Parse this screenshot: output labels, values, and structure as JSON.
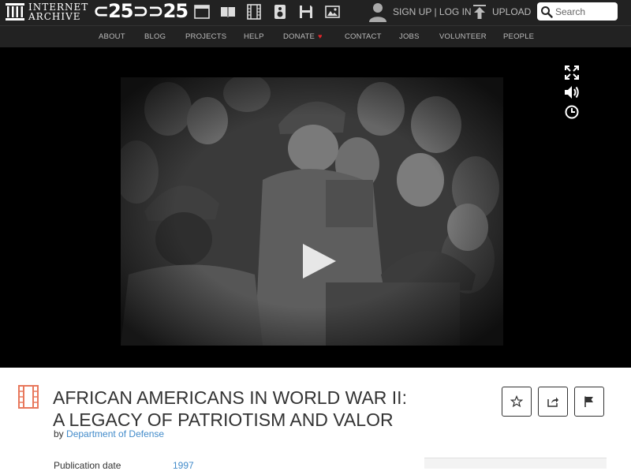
{
  "topbar": {
    "logo_line1": "INTERNET",
    "logo_line2": "ARCHIVE",
    "anniversary_mark": "⊂25⊃⊃25",
    "signup_login": "SIGN UP | LOG IN",
    "upload": "UPLOAD",
    "search_placeholder": "Search",
    "media_icons": [
      "web-icon",
      "texts-icon",
      "video-icon",
      "audio-icon",
      "software-icon",
      "images-icon"
    ]
  },
  "nav": {
    "items": [
      "ABOUT",
      "BLOG",
      "PROJECTS",
      "HELP",
      "DONATE",
      "CONTACT",
      "JOBS",
      "VOLUNTEER",
      "PEOPLE"
    ],
    "donate_heart": "♥"
  },
  "player": {
    "controls": [
      "fullscreen-icon",
      "volume-icon",
      "clock-icon"
    ]
  },
  "item": {
    "title_line1": "AFRICAN AMERICANS IN WORLD WAR II:",
    "title_line2": "A LEGACY OF PATRIOTISM AND VALOR",
    "by_label": "by",
    "author": "Department of Defense",
    "meta": [
      {
        "label": "Publication date",
        "value": "1997"
      }
    ]
  },
  "colors": {
    "topbar_bg": "#222222",
    "nav_text": "#bbbbbb",
    "link": "#428bca",
    "heart": "#e0262a",
    "film_icon": "#e8785c"
  }
}
